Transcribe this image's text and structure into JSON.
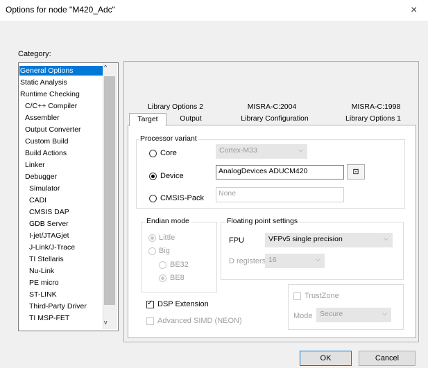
{
  "window": {
    "title": "Options for node \"M420_Adc\"",
    "close_glyph": "×"
  },
  "category": {
    "label": "Category:",
    "items": [
      "General Options",
      "Static Analysis",
      "Runtime Checking",
      "C/C++ Compiler",
      "Assembler",
      "Output Converter",
      "Custom Build",
      "Build Actions",
      "Linker",
      "Debugger",
      "Simulator",
      "CADI",
      "CMSIS DAP",
      "GDB Server",
      "I-jet/JTAGjet",
      "J-Link/J-Trace",
      "TI Stellaris",
      "Nu-Link",
      "PE micro",
      "ST-LINK",
      "Third-Party Driver",
      "TI MSP-FET"
    ],
    "selected": "General Options",
    "scroll_up": "^",
    "scroll_down": "v"
  },
  "tabs": {
    "row1": [
      "Library Options 2",
      "MISRA-C:2004",
      "MISRA-C:1998"
    ],
    "row2": [
      "Target",
      "Output",
      "Library Configuration",
      "Library Options 1"
    ],
    "active": "Target"
  },
  "processor": {
    "group_label": "Processor variant",
    "core_label": "Core",
    "core_value": "Cortex-M33",
    "device_label": "Device",
    "device_value": "AnalogDevices ADUCM420",
    "cmsis_label": "CMSIS-Pack",
    "cmsis_value": "None",
    "selected": "Device",
    "browse_icon": "device-select-icon",
    "browse_glyph": "⊡"
  },
  "endian": {
    "group_label": "Endian mode",
    "little": "Little",
    "big": "Big",
    "be32": "BE32",
    "be8": "BE8"
  },
  "fp": {
    "group_label": "Floating point settings",
    "fpu_label": "FPU",
    "fpu_value": "VFPv5 single precision",
    "dreg_label": "D registers",
    "dreg_value": "16"
  },
  "dsp_label": "DSP Extension",
  "simd_label": "Advanced SIMD (NEON)",
  "trustzone": {
    "label": "TrustZone",
    "mode_label": "Mode",
    "mode_value": "Secure"
  },
  "buttons": {
    "ok": "OK",
    "cancel": "Cancel"
  },
  "colors": {
    "selection": "#0078d7",
    "dialog_bg": "#f0f0f0"
  },
  "glyphs": {
    "combo_arrow": "⌵",
    "check": "✓"
  }
}
